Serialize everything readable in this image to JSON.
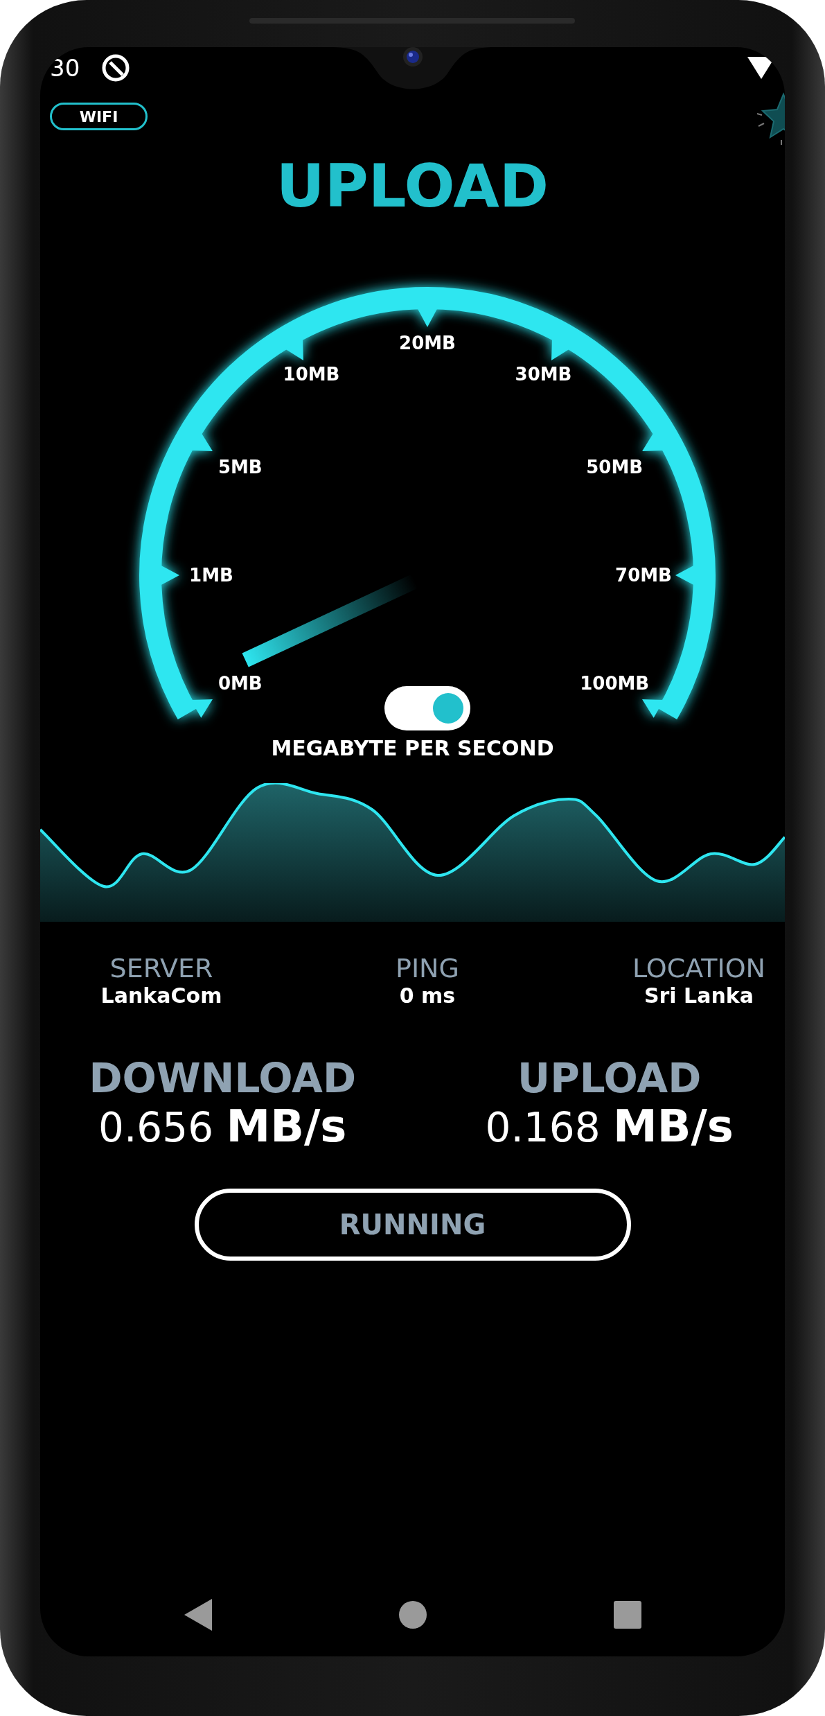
{
  "status_bar": {
    "time": "30"
  },
  "network_badge": "WIFI",
  "title": "UPLOAD",
  "gauge": {
    "tick_labels": [
      "0MB",
      "1MB",
      "5MB",
      "10MB",
      "20MB",
      "30MB",
      "50MB",
      "70MB",
      "100MB"
    ]
  },
  "unit_toggle": {
    "on": true,
    "label": "MEGABYTE PER SECOND"
  },
  "info": [
    {
      "label": "SERVER",
      "value": "LankaCom"
    },
    {
      "label": "PING",
      "value": "0 **ms**"
    },
    {
      "label": "LOCATION",
      "value": "Sri Lanka"
    }
  ],
  "results": [
    {
      "label": "DOWNLOAD",
      "value": "0.656 **MB/s**"
    },
    {
      "label": "UPLOAD",
      "value": "0.168 **MB/s**"
    }
  ],
  "action_button": "RUNNING"
}
